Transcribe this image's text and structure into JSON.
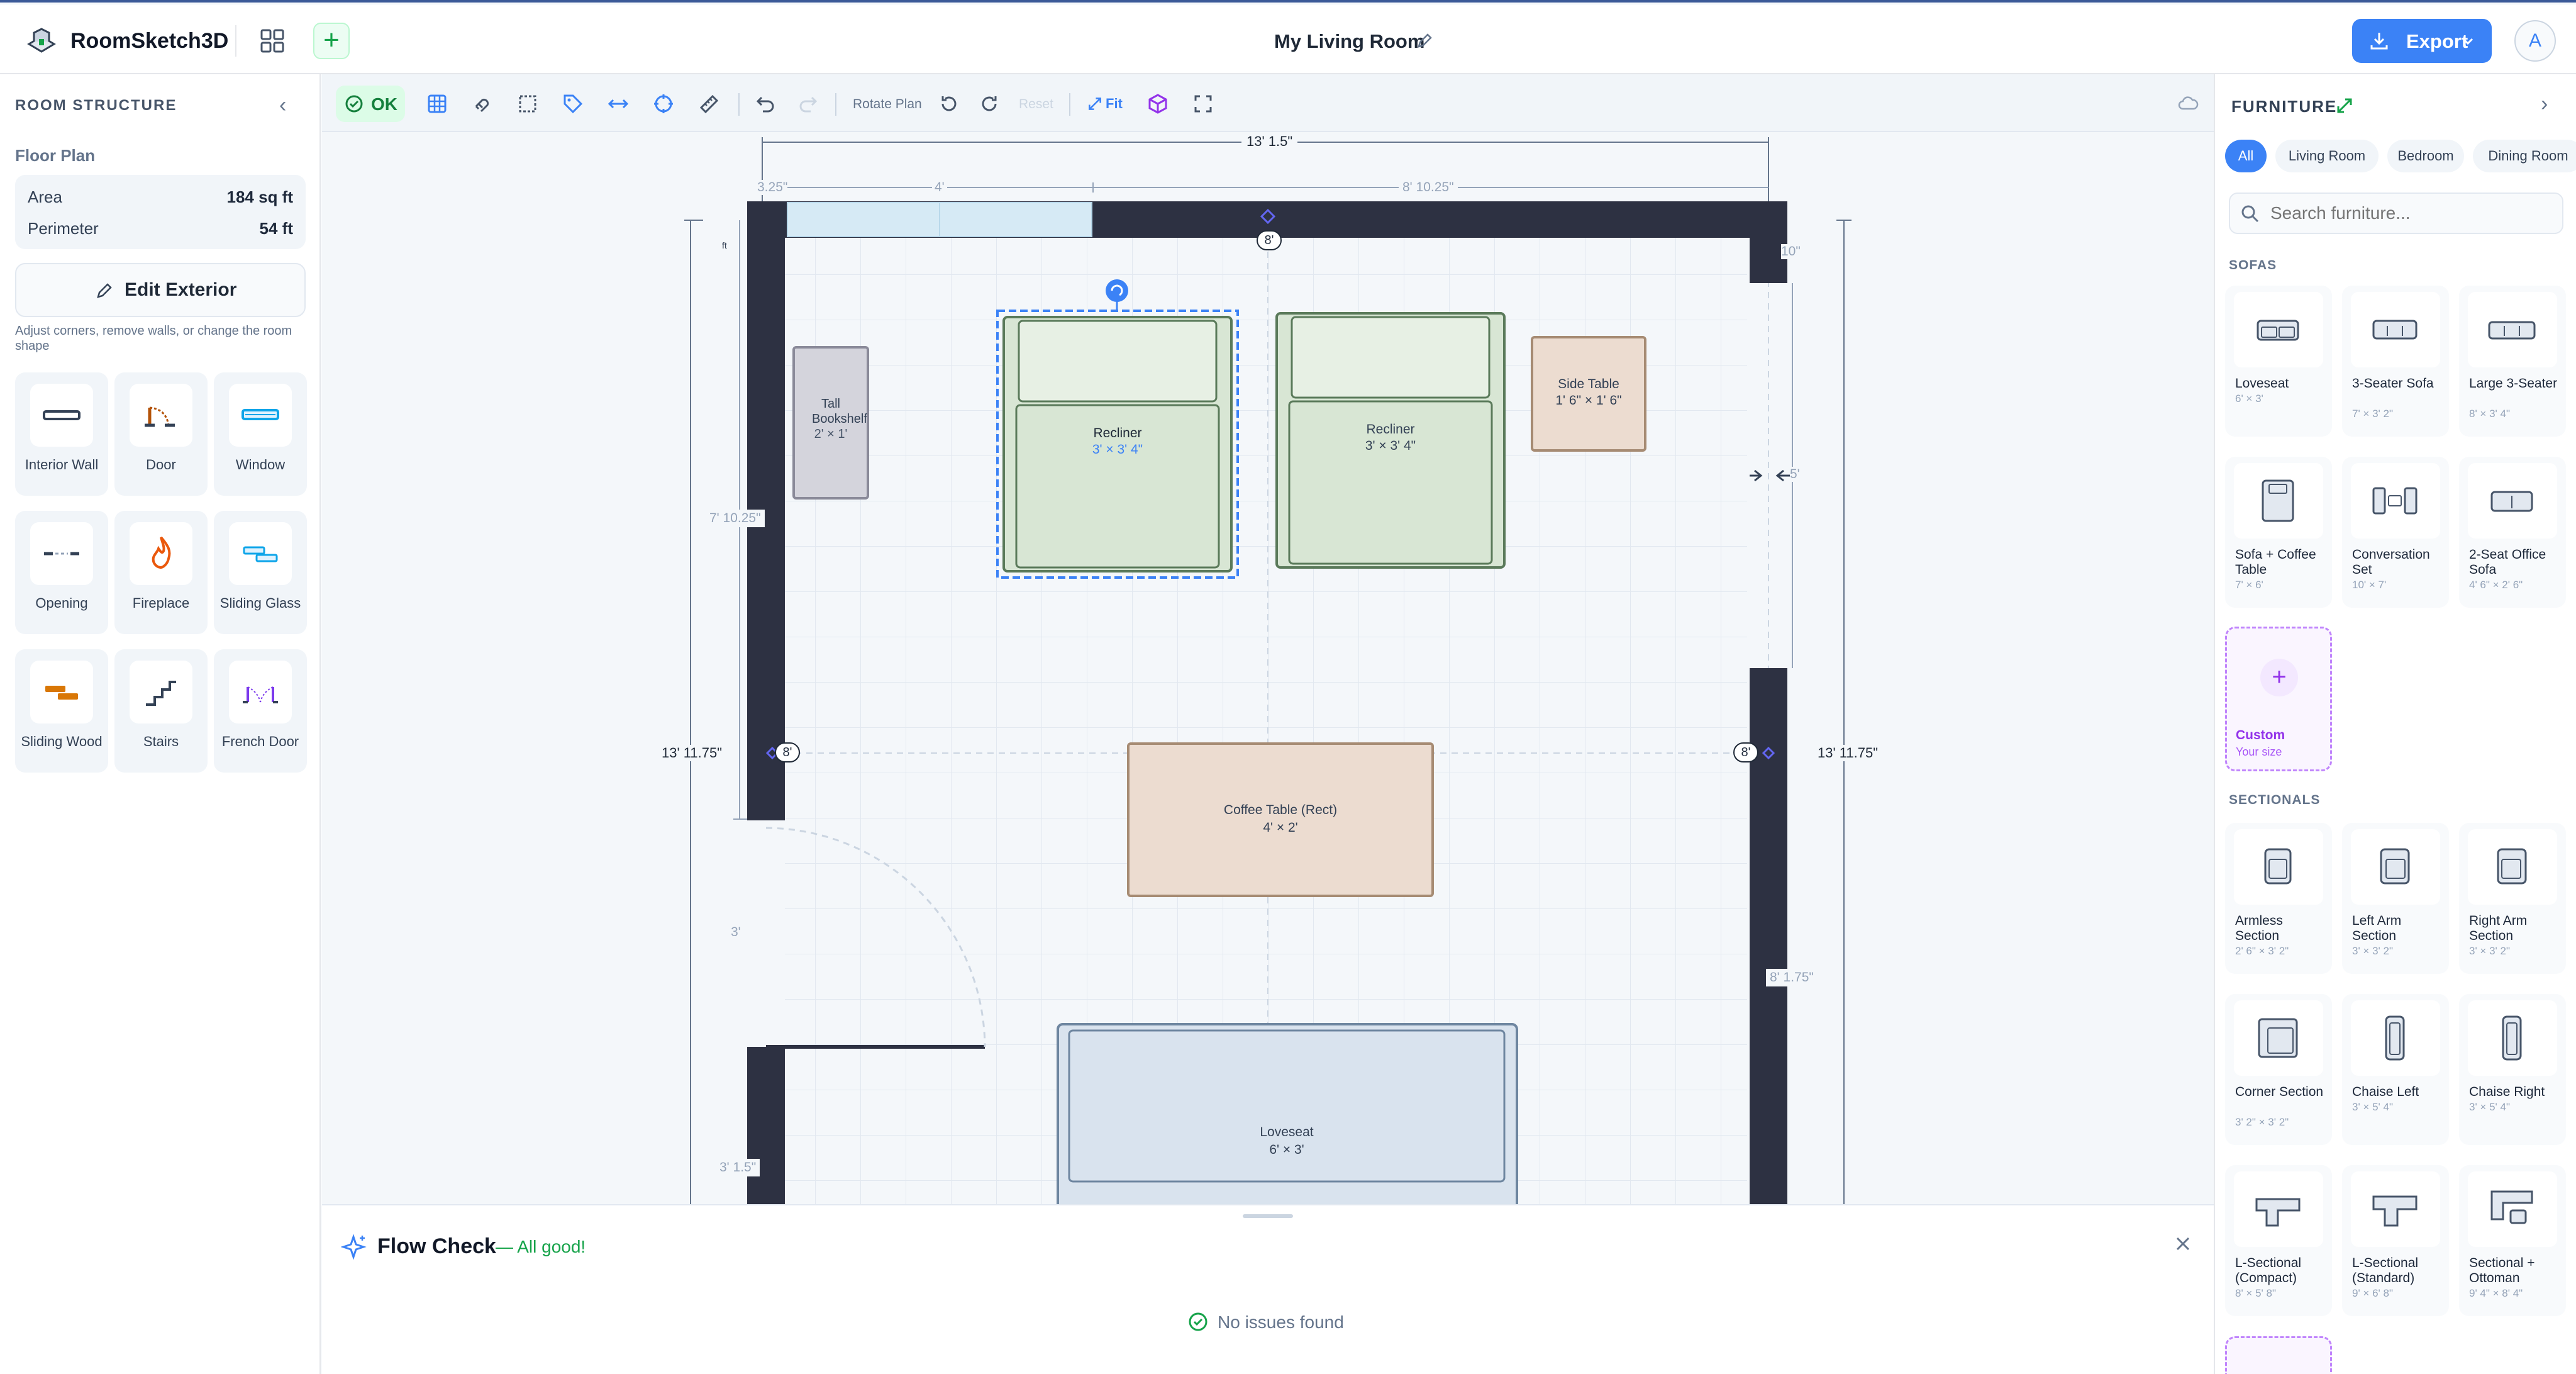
{
  "app": {
    "name": "RoomSketch3D",
    "title": "My Living Room",
    "export_label": "Export",
    "avatar": "A",
    "brand_color": "#3b82f6"
  },
  "left_panel": {
    "title": "ROOM STRUCTURE",
    "floor_plan_label": "Floor Plan",
    "stats": [
      {
        "label": "Area",
        "value": "184 sq ft"
      },
      {
        "label": "Perimeter",
        "value": "54 ft"
      }
    ],
    "edit_exterior_label": "Edit Exterior",
    "hint": "Adjust corners, remove walls, or change the room shape",
    "tools": [
      {
        "label": "Interior Wall",
        "icon": "interior-wall-icon"
      },
      {
        "label": "Door",
        "icon": "door-icon"
      },
      {
        "label": "Window",
        "icon": "window-icon"
      },
      {
        "label": "Opening",
        "icon": "opening-icon"
      },
      {
        "label": "Fireplace",
        "icon": "fireplace-icon"
      },
      {
        "label": "Sliding Glass",
        "icon": "sliding-glass-icon"
      },
      {
        "label": "Sliding Wood",
        "icon": "sliding-wood-icon"
      },
      {
        "label": "Stairs",
        "icon": "stairs-icon"
      },
      {
        "label": "French Door",
        "icon": "french-door-icon"
      }
    ]
  },
  "toolbar": {
    "ok_label": "OK",
    "rotate_label": "Rotate Plan",
    "reset_label": "Reset",
    "fit_label": "Fit"
  },
  "plan": {
    "dimensions": {
      "top_total": "13' 1.5\"",
      "top_left_a": "3.25\"",
      "top_left_b": "4'",
      "top_right": "8' 10.25\"",
      "ceiling_top": "8'",
      "right_small": "10\"",
      "right_gap": "5'",
      "left_upper": "7' 10.25\"",
      "left_total": "13' 11.75\"",
      "right_total": "13' 11.75\"",
      "ceiling_left": "8'",
      "ceiling_right": "8'",
      "door_width": "3'",
      "right_lower": "8' 1.75\"",
      "left_bottom": "3' 1.5\"",
      "inches": "ft"
    },
    "items": [
      {
        "name": "Tall Bookshelf",
        "dims": "2' × 1'"
      },
      {
        "name": "Recliner",
        "dims": "3' × 3' 4\""
      },
      {
        "name": "Recliner",
        "dims": "3' × 3' 4\""
      },
      {
        "name": "Side Table",
        "dims": "1' 6\" × 1' 6\""
      },
      {
        "name": "Coffee Table (Rect)",
        "dims": "4' × 2'"
      },
      {
        "name": "Loveseat",
        "dims": "6' × 3'"
      }
    ]
  },
  "right_panel": {
    "title": "FURNITURE",
    "tabs": [
      "All",
      "Living Room",
      "Bedroom",
      "Dining Room"
    ],
    "search_placeholder": "Search furniture...",
    "sofas_header": "SOFAS",
    "sofas": [
      {
        "name": "Loveseat",
        "dims": "6' × 3'"
      },
      {
        "name": "3-Seater Sofa",
        "dims": "7' × 3' 2\""
      },
      {
        "name": "Large 3-Seater",
        "dims": "8' × 3' 4\""
      },
      {
        "name": "Sofa + Coffee Table",
        "dims": "7' × 6'"
      },
      {
        "name": "Conversation Set",
        "dims": "10' × 7'"
      },
      {
        "name": "2-Seat Office Sofa",
        "dims": "4' 6\" × 2' 6\""
      }
    ],
    "custom": {
      "name": "Custom",
      "sub": "Your size"
    },
    "sectionals_header": "SECTIONALS",
    "sectionals": [
      {
        "name": "Armless Section",
        "dims": "2' 6\" × 3' 2\""
      },
      {
        "name": "Left Arm Section",
        "dims": "3' × 3' 2\""
      },
      {
        "name": "Right Arm Section",
        "dims": "3' × 3' 2\""
      },
      {
        "name": "Corner Section",
        "dims": "3' 2\" × 3' 2\""
      },
      {
        "name": "Chaise Left",
        "dims": "3' × 5' 4\""
      },
      {
        "name": "Chaise Right",
        "dims": "3' × 5' 4\""
      },
      {
        "name": "L-Sectional (Compact)",
        "dims": "8' × 5' 8\""
      },
      {
        "name": "L-Sectional (Standard)",
        "dims": "9' × 6' 8\""
      },
      {
        "name": "Sectional + Ottoman",
        "dims": "9' 4\" × 8' 4\""
      }
    ]
  },
  "flow_check": {
    "title": "Flow Check",
    "status": "— All good!",
    "message": "No issues found"
  }
}
